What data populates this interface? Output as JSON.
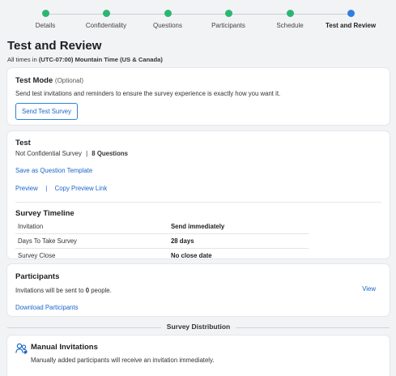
{
  "stepper": {
    "steps": [
      {
        "label": "Details",
        "state": "complete"
      },
      {
        "label": "Confidentiality",
        "state": "complete"
      },
      {
        "label": "Questions",
        "state": "complete"
      },
      {
        "label": "Participants",
        "state": "complete"
      },
      {
        "label": "Schedule",
        "state": "complete"
      },
      {
        "label": "Test and Review",
        "state": "current"
      }
    ],
    "colors": {
      "complete": "#2bb673",
      "current": "#2f7fe0"
    }
  },
  "header": {
    "title": "Test and Review",
    "tz_prefix": "All times in",
    "tz_value": "(UTC-07:00) Mountain Time (US & Canada)"
  },
  "test_mode": {
    "title": "Test Mode",
    "optional": "(Optional)",
    "description": "Send test invitations and reminders to ensure the survey experience is exactly how you want it.",
    "button": "Send Test Survey"
  },
  "test": {
    "title": "Test",
    "confidential": "Not Confidential Survey",
    "separator": "|",
    "question_count": "8",
    "questions_label": "Questions",
    "save_template": "Save as Question Template",
    "preview": "Preview",
    "copy_link": "Copy Preview Link"
  },
  "timeline": {
    "title": "Survey Timeline",
    "rows": [
      {
        "label": "Invitation",
        "value": "Send immediately"
      },
      {
        "label": "Days To Take Survey",
        "value": "28 days"
      },
      {
        "label": "Survey Close",
        "value": "No close date"
      }
    ]
  },
  "participants": {
    "title": "Participants",
    "text_before": "Invitations will be sent to",
    "count": "0",
    "text_after": "people.",
    "view": "View",
    "download": "Download Participants"
  },
  "distribution": {
    "heading": "Survey Distribution",
    "manual_title": "Manual Invitations",
    "manual_desc": "Manually added participants will receive an invitation immediately.",
    "icon": "people-icon",
    "accent": "#1a66c9"
  }
}
